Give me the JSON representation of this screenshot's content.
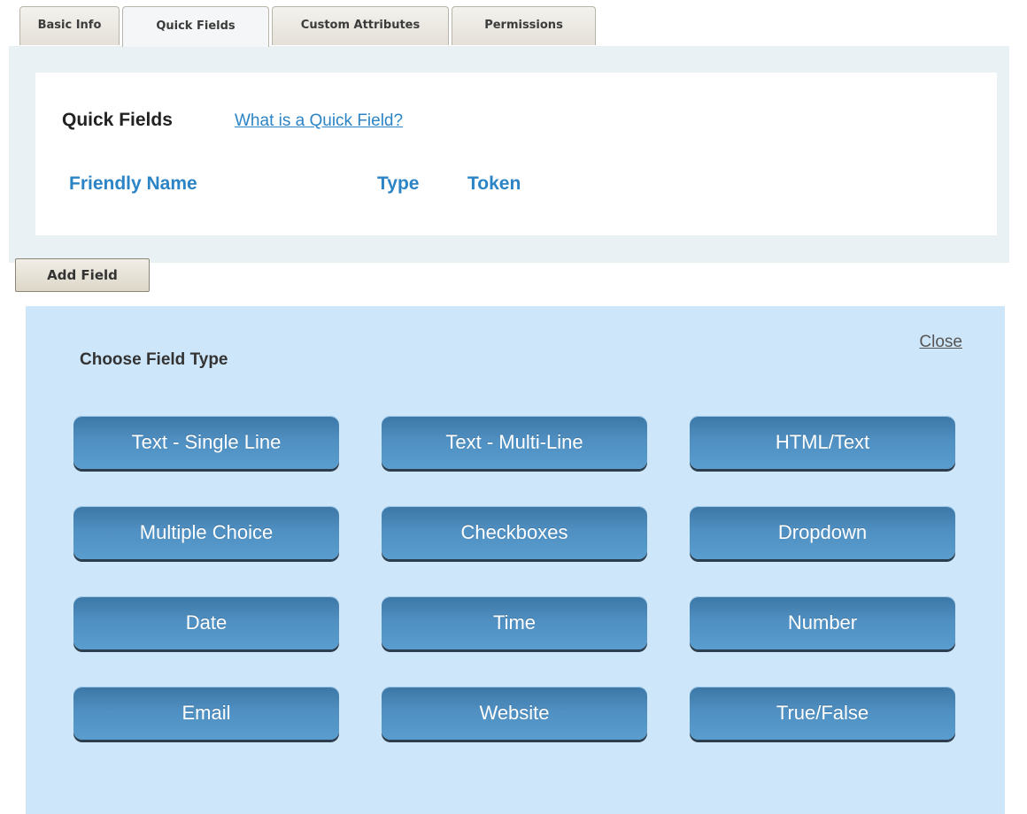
{
  "tabs": [
    {
      "label": "Basic Info"
    },
    {
      "label": "Quick Fields"
    },
    {
      "label": "Custom Attributes"
    },
    {
      "label": "Permissions"
    }
  ],
  "quick_fields": {
    "title": "Quick Fields",
    "help_link": "What is a Quick Field?",
    "columns": [
      "Friendly Name",
      "Type",
      "Token"
    ]
  },
  "add_field_label": "Add Field",
  "chooser": {
    "title": "Choose Field Type",
    "close_label": "Close",
    "field_types": [
      "Text - Single Line",
      "Text - Multi-Line",
      "HTML/Text",
      "Multiple Choice",
      "Checkboxes",
      "Dropdown",
      "Date",
      "Time",
      "Number",
      "Email",
      "Website",
      "True/False"
    ]
  }
}
